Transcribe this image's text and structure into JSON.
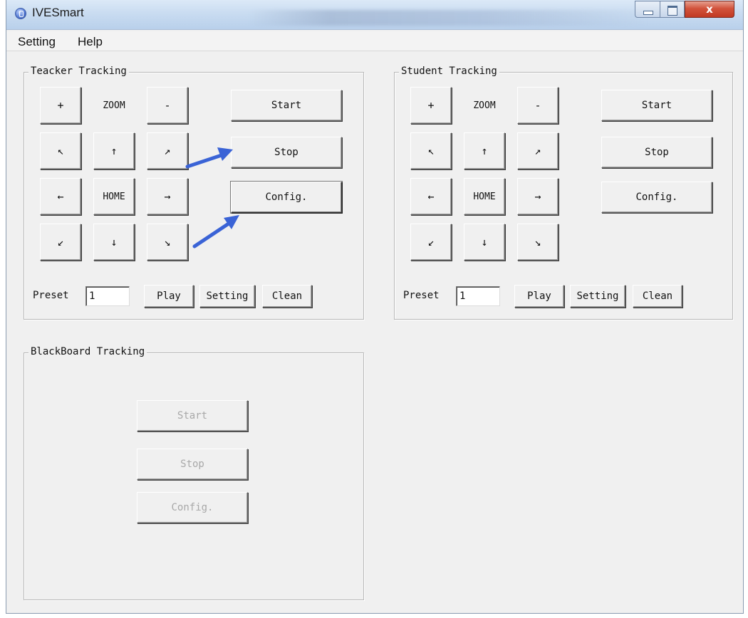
{
  "window": {
    "title": "IVESmart",
    "close_glyph": "x"
  },
  "menu": [
    "Setting",
    "Help"
  ],
  "teacher": {
    "title": "Teacker Tracking",
    "zoom_in": "+",
    "zoom_label": "ZOOM",
    "zoom_out": "-",
    "nw": "↖",
    "up": "↑",
    "ne": "↗",
    "left": "←",
    "home": "HOME",
    "right": "→",
    "sw": "↙",
    "down": "↓",
    "se": "↘",
    "start": "Start",
    "stop": "Stop",
    "config": "Config.",
    "preset_label": "Preset",
    "preset_value": "1",
    "play": "Play",
    "setting": "Setting",
    "clean": "Clean"
  },
  "student": {
    "title": "Student Tracking",
    "zoom_in": "+",
    "zoom_label": "ZOOM",
    "zoom_out": "-",
    "nw": "↖",
    "up": "↑",
    "ne": "↗",
    "left": "←",
    "home": "HOME",
    "right": "→",
    "sw": "↙",
    "down": "↓",
    "se": "↘",
    "start": "Start",
    "stop": "Stop",
    "config": "Config.",
    "preset_label": "Preset",
    "preset_value": "1",
    "play": "Play",
    "setting": "Setting",
    "clean": "Clean"
  },
  "blackboard": {
    "title": "BlackBoard Tracking",
    "start": "Start",
    "stop": "Stop",
    "config": "Config."
  },
  "annotation_color": "#3a63d6"
}
